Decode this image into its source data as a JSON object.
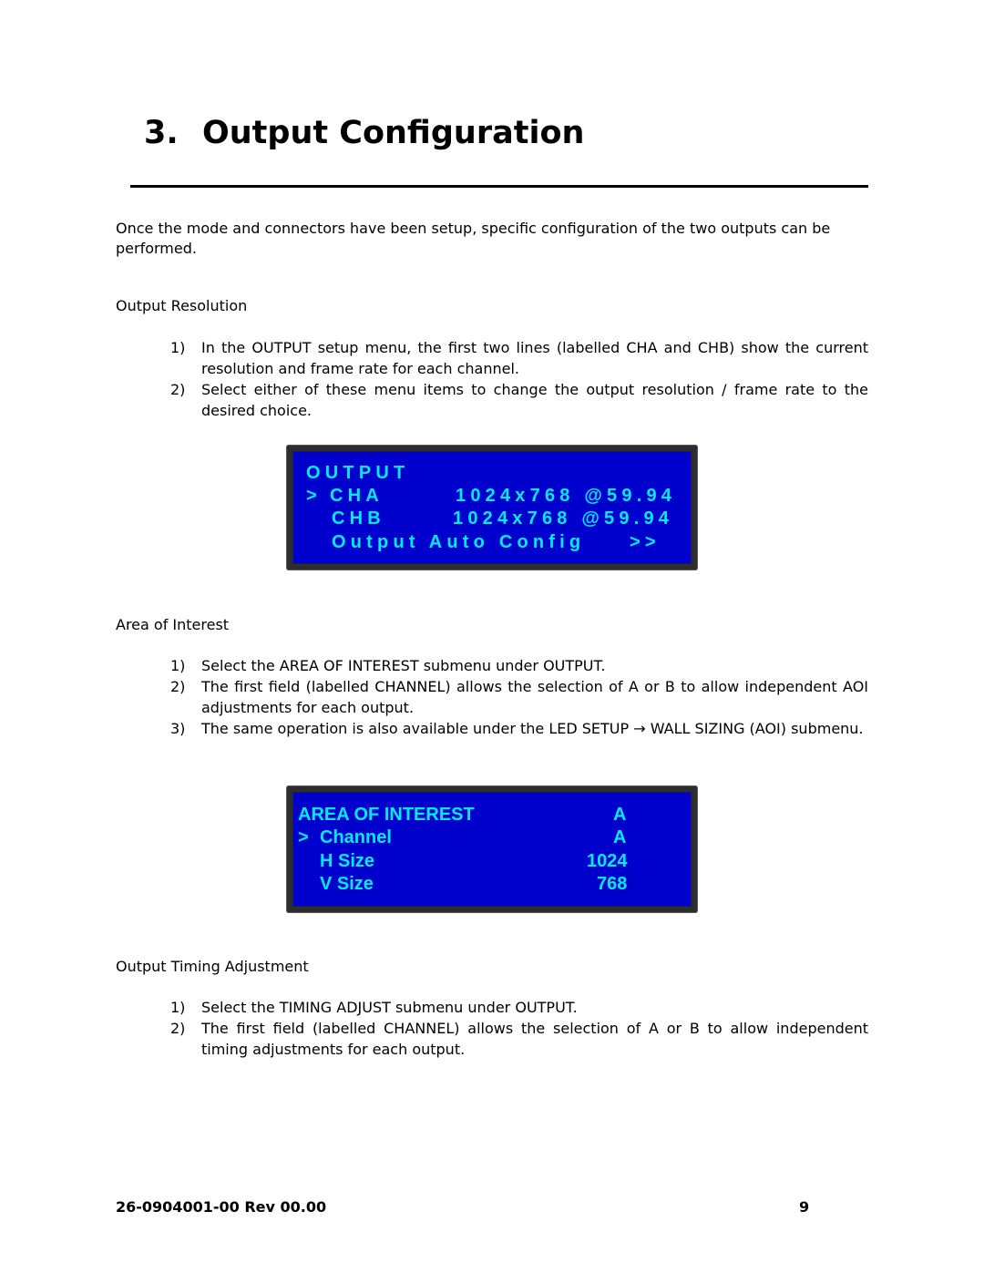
{
  "chapter": {
    "number": "3.",
    "title": "Output Configuration"
  },
  "intro": "Once the mode and connectors have been setup, specific configuration of the two outputs can be performed.",
  "sections": [
    {
      "heading": "Output Resolution",
      "steps": [
        {
          "n": "1)",
          "text": "In the OUTPUT setup menu, the first two lines (labelled CHA and CHB) show the current resolution and frame rate for each channel."
        },
        {
          "n": "2)",
          "text": "Select either of these menu items to change the output resolution / frame rate to the desired choice."
        }
      ]
    },
    {
      "heading": "Area of Interest",
      "steps": [
        {
          "n": "1)",
          "text": "Select the AREA OF INTEREST submenu under OUTPUT."
        },
        {
          "n": "2)",
          "text": "The first field (labelled CHANNEL) allows the selection of A or B to allow independent AOI adjustments for each output."
        },
        {
          "n": "3)",
          "text": "The same operation is also available under the LED SETUP → WALL SIZING (AOI) submenu."
        }
      ]
    },
    {
      "heading": "Output Timing Adjustment",
      "steps": [
        {
          "n": "1)",
          "text": "Select the TIMING ADJUST submenu under OUTPUT."
        },
        {
          "n": "2)",
          "text": "The first field (labelled CHANNEL) allows the selection of A or B to allow independent timing adjustments for each output."
        }
      ]
    }
  ],
  "lcd_output": {
    "title": "OUTPUT",
    "rows": [
      {
        "cursor": ">",
        "label": "CHA",
        "value": "1024x768 @59.94"
      },
      {
        "cursor": "",
        "label": "CHB",
        "value": "1024x768 @59.94"
      },
      {
        "cursor": "",
        "label": "Output Auto Config",
        "value": ">>"
      }
    ]
  },
  "lcd_aoi": {
    "title": "AREA OF INTEREST",
    "title_value": "A",
    "rows": [
      {
        "cursor": ">",
        "label": "Channel",
        "value": "A"
      },
      {
        "cursor": "",
        "label": "H Size",
        "value": "1024"
      },
      {
        "cursor": "",
        "label": "V Size",
        "value": "768"
      }
    ]
  },
  "colors": {
    "lcd_background": "#0000cc",
    "lcd_text": "#00eaff",
    "lcd_bezel": "#2e2e2e"
  },
  "footer": {
    "doc_number": "26-0904001-00 Rev 00.00",
    "page_number": "9"
  }
}
